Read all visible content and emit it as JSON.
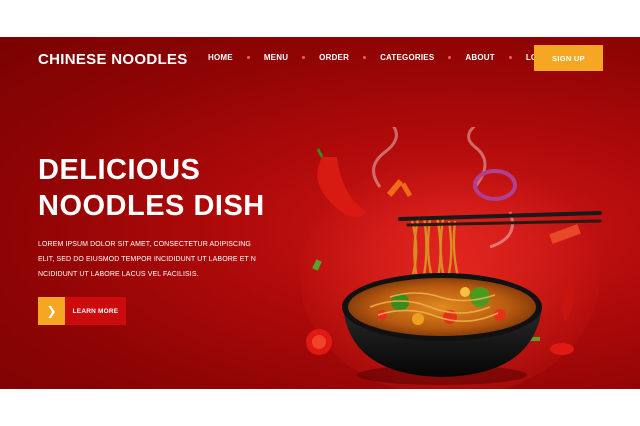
{
  "brand": "CHINESE NOODLES",
  "nav": {
    "items": [
      "HOME",
      "MENU",
      "ORDER",
      "CATEGORIES",
      "ABOUT",
      "LOCATION"
    ],
    "signup_label": "SIGN UP"
  },
  "hero": {
    "headline_line1": "DELICIOUS",
    "headline_line2": "NOODLES DISH",
    "description_lines": [
      "LOREM IPSUM DOLOR SIT AMET, CONSECTETUR ADIPISCING",
      "ELIT, SED DO EIUSMOD TEMPOR INCIDIDUNT UT LABORE ET N",
      "NCIDIDUNT UT LABORE LACUS VEL FACILISIS."
    ],
    "cta_label": "LEARN MORE",
    "cta_icon": "chevron-right-icon"
  },
  "colors": {
    "hero_background": "#a80808",
    "accent": "#f5a623",
    "cta_label_bg": "#cc0c0c",
    "nav_separator": "#ff5a4a"
  },
  "image": {
    "subject": "noodle-bowl-with-chopsticks"
  }
}
